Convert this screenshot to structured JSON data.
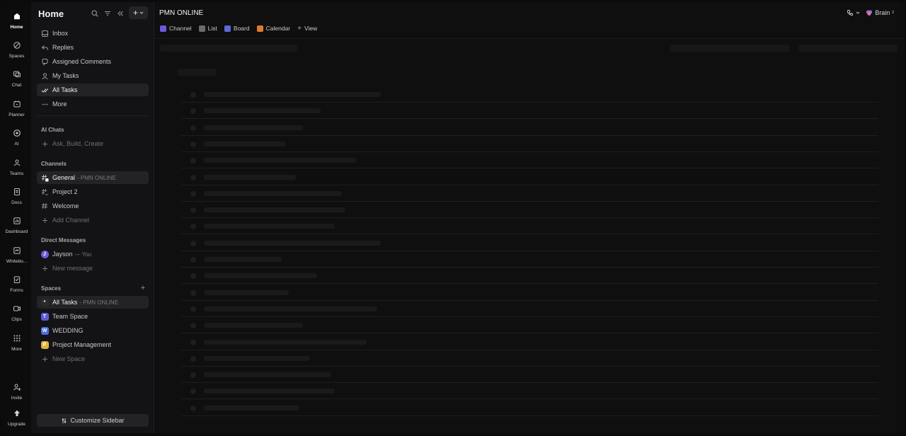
{
  "rail": [
    {
      "label": "Home",
      "icon": "home-icon",
      "active": true
    },
    {
      "label": "Spaces",
      "icon": "spaces-icon"
    },
    {
      "label": "Chat",
      "icon": "chat-icon"
    },
    {
      "label": "Planner",
      "icon": "planner-icon"
    },
    {
      "label": "AI",
      "icon": "ai-icon"
    },
    {
      "label": "Teams",
      "icon": "teams-icon"
    },
    {
      "label": "Docs",
      "icon": "docs-icon"
    },
    {
      "label": "Dashboard",
      "icon": "dashboard-icon"
    },
    {
      "label": "Whitebo...",
      "icon": "whiteboard-icon"
    },
    {
      "label": "Forms",
      "icon": "forms-icon"
    },
    {
      "label": "Clips",
      "icon": "clips-icon"
    },
    {
      "label": "More",
      "icon": "grid-icon"
    },
    {
      "label": "Invite",
      "icon": "invite-icon"
    },
    {
      "label": "Upgrade",
      "icon": "upgrade-icon"
    }
  ],
  "sidebar": {
    "title": "Home",
    "nav": [
      {
        "label": "Inbox",
        "icon": "inbox-icon"
      },
      {
        "label": "Replies",
        "icon": "reply-icon"
      },
      {
        "label": "Assigned Comments",
        "icon": "comment-icon"
      },
      {
        "label": "My Tasks",
        "icon": "user-icon"
      },
      {
        "label": "All Tasks",
        "icon": "check-double-icon",
        "active": true
      },
      {
        "label": "More",
        "icon": "ellipsis-icon"
      }
    ],
    "ai_chats": {
      "title": "AI Chats",
      "action": "Ask, Build, Create"
    },
    "channels": {
      "title": "Channels",
      "items": [
        {
          "label": "General",
          "suffix": "- PMN ONLINE",
          "active": true
        },
        {
          "label": "Project 2"
        },
        {
          "label": "Welcome"
        }
      ],
      "add": "Add Channel"
    },
    "dms": {
      "title": "Direct Messages",
      "items": [
        {
          "label": "Jayson",
          "suffix": "— You",
          "avatar": "J"
        }
      ],
      "add": "New message"
    },
    "spaces": {
      "title": "Spaces",
      "items": [
        {
          "label": "All Tasks",
          "suffix": "- PMN ONLINE",
          "badge": "*",
          "color": "#2a2a2c",
          "active": true
        },
        {
          "label": "Team Space",
          "badge": "T",
          "color": "#5b5bd6"
        },
        {
          "label": "WEDDING",
          "badge": "W",
          "color": "#4a6fe0"
        },
        {
          "label": "Project Management",
          "badge": "P",
          "color": "#e0b43a"
        }
      ],
      "add": "New Space"
    },
    "customize": "Customize Sidebar"
  },
  "main": {
    "title": "PMN ONLINE",
    "tabs": [
      {
        "label": "Channel",
        "color": "#6a5bd8"
      },
      {
        "label": "List",
        "color": "#6b6b6b"
      },
      {
        "label": "Board",
        "color": "#5b6bd8"
      },
      {
        "label": "Calendar",
        "color": "#e07b2a"
      }
    ],
    "add_view": "View",
    "brain": "Brain"
  }
}
